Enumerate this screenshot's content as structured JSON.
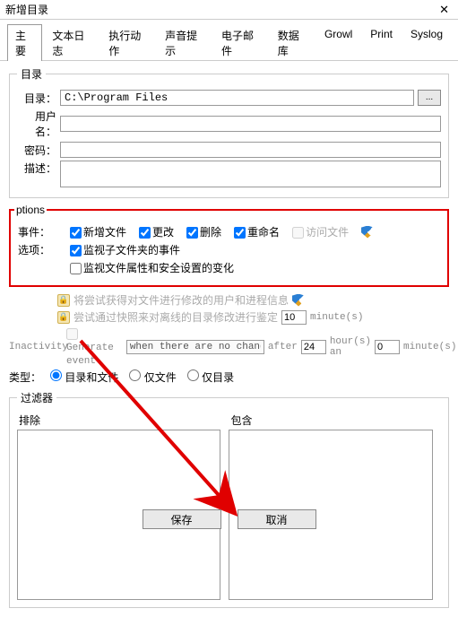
{
  "window": {
    "title": "新增目录",
    "close_glyph": "✕"
  },
  "tabs": [
    {
      "id": "main",
      "label": "主要",
      "active": true
    },
    {
      "id": "textlog",
      "label": "文本日志"
    },
    {
      "id": "actions",
      "label": "执行动作"
    },
    {
      "id": "sound",
      "label": "声音提示"
    },
    {
      "id": "email",
      "label": "电子邮件"
    },
    {
      "id": "database",
      "label": "数据库"
    },
    {
      "id": "growl",
      "label": "Growl"
    },
    {
      "id": "print",
      "label": "Print"
    },
    {
      "id": "syslog",
      "label": "Syslog"
    }
  ],
  "sections": {
    "dir": {
      "legend": "目录",
      "dir_label": "目录：",
      "dir_value": "C:\\Program Files",
      "browse_label": "...",
      "user_label": "用户名：",
      "user_value": "",
      "pwd_label": "密码：",
      "pwd_value": "",
      "desc_label": "描述：",
      "desc_value": ""
    },
    "options": {
      "legend": "ptions",
      "events_label": "事件：",
      "opts_label": "选项：",
      "cb_new": "新增文件",
      "cb_change": "更改",
      "cb_delete": "删除",
      "cb_rename": "重命名",
      "cb_access": "访问文件",
      "cb_subfolders": "监视子文件夹的事件",
      "cb_attrs": "监视文件属性和安全设置的变化",
      "lock_row1": "将尝试获得对文件进行修改的用户和进程信息",
      "lock_row2_prefix": "尝试通过快照来对离线的目录修改进行鉴定",
      "snapshot_minutes": "10",
      "minutes_suffix": "minute(s)",
      "inactivity_label": "Inactivity",
      "generate_label": "Generate event",
      "select_value": "when there are no changes f",
      "after_label": "after",
      "hours_value": "24",
      "hours_suffix": "hour(s) an",
      "min2_value": "0",
      "min2_suffix": "minute(s)"
    },
    "type": {
      "label": "类型：",
      "r_both": "目录和文件",
      "r_files": "仅文件",
      "r_dirs": "仅目录"
    },
    "filters": {
      "legend": "过滤器",
      "exclude_label": "排除",
      "include_label": "包含"
    }
  },
  "buttons": {
    "save": "保存",
    "cancel": "取消"
  }
}
